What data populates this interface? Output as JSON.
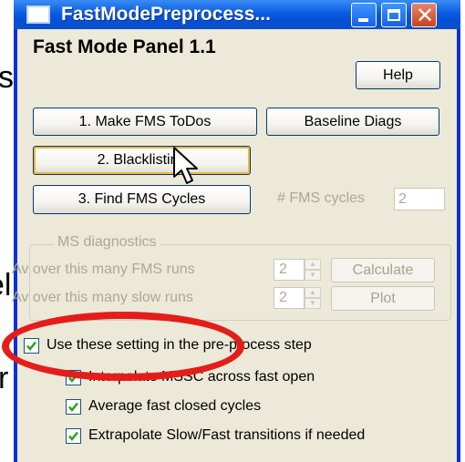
{
  "background_text": {
    "line1": "s",
    "line2": "el,",
    "line3": "r"
  },
  "window": {
    "title": "FastModePreprocess...",
    "controls": {
      "minimize": "minimize-icon",
      "maximize": "maximize-icon",
      "close": "close-icon"
    }
  },
  "panel": {
    "title": "Fast Mode Panel 1.1",
    "help_label": "Help",
    "buttons": {
      "make_todos": "1. Make FMS ToDos",
      "baseline_diags": "Baseline Diags",
      "blacklisting": "2. Blacklisting",
      "find_cycles": "3. Find FMS Cycles"
    },
    "fms_cycles": {
      "label": "# FMS cycles",
      "value": "2"
    }
  },
  "ms_diagnostics": {
    "legend": "MS diagnostics",
    "row1_label": "Av over this many FMS runs",
    "row1_value": "2",
    "row2_label": "Av over this many slow runs",
    "row2_value": "2",
    "calculate_label": "Calculate",
    "plot_label": "Plot"
  },
  "options": [
    {
      "label": "Use these setting in the pre-process step",
      "checked": true
    },
    {
      "label": "Interpolate MSSC across fast open",
      "checked": true
    },
    {
      "label": "Average fast closed cycles",
      "checked": true
    },
    {
      "label": "Extrapolate Slow/Fast transitions if needed",
      "checked": true
    }
  ],
  "colors": {
    "window_bg": "#ece9d8",
    "titlebar_blue": "#0a5ce0",
    "annotation_red": "#e31d1a",
    "check_green": "#21a121"
  }
}
